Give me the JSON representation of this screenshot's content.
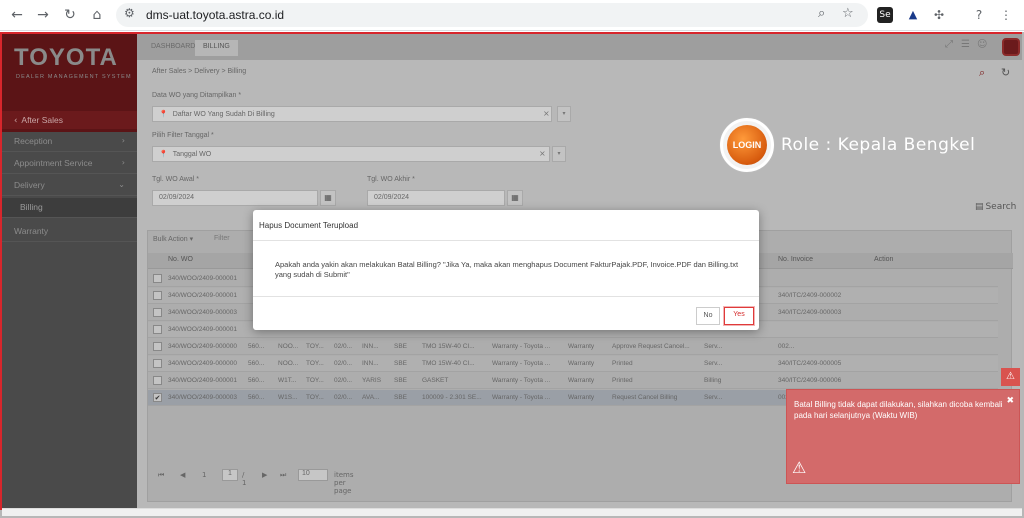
{
  "browser": {
    "url": "dms-uat.toyota.astra.co.id"
  },
  "brand": {
    "title": "TOYOTA",
    "subtitle": "DEALER MANAGEMENT SYSTEM"
  },
  "sidebar": {
    "section": "After Sales",
    "items": [
      {
        "label": "Reception",
        "chevron": "›"
      },
      {
        "label": "Appointment Service",
        "chevron": "›"
      },
      {
        "label": "Delivery",
        "chevron": "⌄"
      },
      {
        "label": "Billing",
        "chevron": ""
      },
      {
        "label": "Warranty",
        "chevron": ""
      }
    ]
  },
  "topbar": {
    "tabs": [
      "DASHBOARD",
      "BILLING"
    ]
  },
  "breadcrumb": "After Sales > Delivery > Billing",
  "form": {
    "data_wo_label": "Data WO yang Ditampilkan *",
    "data_wo_value": "Daftar WO Yang Sudah Di Billing",
    "filter_label": "Pilih Filter Tanggal *",
    "filter_value": "Tanggal WO",
    "wo_awal_label": "Tgl. WO Awal *",
    "wo_awal_value": "02/09/2024",
    "wo_akhir_label": "Tgl. WO Akhir *",
    "wo_akhir_value": "02/09/2024",
    "search_label": "Search"
  },
  "grid": {
    "bulk_action": "Bulk Action ▾",
    "filter": "Filter",
    "headers": [
      "No. WO",
      "No. Invoice",
      "Action"
    ],
    "rows": [
      {
        "cells": [
          "340/WOO/2409-000001",
          "",
          "",
          "",
          "",
          "",
          "",
          "",
          "",
          "",
          "",
          "",
          "",
          ""
        ],
        "selected": false
      },
      {
        "cells": [
          "340/WOO/2409-000001",
          "",
          "",
          "",
          "",
          "",
          "",
          "",
          "",
          "",
          "",
          "",
          "340/ITC/2409-000002",
          ""
        ],
        "selected": false
      },
      {
        "cells": [
          "340/WOO/2409-000003",
          "",
          "",
          "",
          "",
          "",
          "",
          "",
          "",
          "",
          "",
          "",
          "340/ITC/2409-000003",
          ""
        ],
        "selected": false
      },
      {
        "cells": [
          "340/WOO/2409-000001",
          "",
          "",
          "",
          "",
          "",
          "",
          "",
          "",
          "",
          "",
          "",
          "",
          ""
        ],
        "selected": false
      },
      {
        "cells": [
          "340/WOO/2409-000000",
          "560...",
          "NOO...",
          "TOY...",
          "02/0...",
          "INN...",
          "SBE",
          "TMO 15W-40 CI...",
          "Warranty - Toyota ...",
          "Warranty",
          "Approve Request Cancel...",
          "Serv...",
          "002...",
          ""
        ],
        "selected": false
      },
      {
        "cells": [
          "340/WOO/2409-000000",
          "560...",
          "NOO...",
          "TOY...",
          "02/0...",
          "INN...",
          "SBE",
          "TMO 15W-40 CI...",
          "Warranty - Toyota ...",
          "Warranty",
          "Printed",
          "Serv...",
          "340/ITC/2409-000005",
          ""
        ],
        "selected": false
      },
      {
        "cells": [
          "340/WOO/2409-000001",
          "560...",
          "W1T...",
          "TOY...",
          "02/0...",
          "YARIS",
          "SBE",
          "GASKET",
          "Warranty - Toyota ...",
          "Warranty",
          "Printed",
          "Billing",
          "340/ITC/2409-000006",
          ""
        ],
        "selected": false
      },
      {
        "cells": [
          "340/WOO/2409-000003",
          "560...",
          "W1S...",
          "TOY...",
          "02/0...",
          "AVA...",
          "SBE",
          "100009 - 2.301 SE...",
          "Warranty - Toyota ...",
          "Warranty",
          "Request Cancel Billing",
          "Serv...",
          "002...",
          ""
        ],
        "selected": true
      }
    ],
    "pager": {
      "first": "⏮",
      "prev": "◀",
      "page_label": "1",
      "page_value": "1",
      "of": "/ 1",
      "next": "▶",
      "last": "⏭",
      "size": "10",
      "size_label": "items per page"
    }
  },
  "badge": {
    "logo_text": "LOGIN",
    "role": "Role : Kepala Bengkel"
  },
  "modal": {
    "title": "Hapus Document Terupload",
    "message": "Apakah anda yakin akan melakukan Batal Billing? \"Jika Ya, maka akan menghapus Document FakturPajak.PDF, Invoice.PDF dan Billing.txt yang sudah di Submit\"",
    "no_label": "No",
    "yes_label": "Yes"
  },
  "toast": {
    "message": "Batal Billing tidak dapat dilakukan, silahkan dicoba kembali pada hari selanjutnya (Waktu WIB)",
    "close": "✖"
  },
  "colors": {
    "brand_red": "#d7262c",
    "toast_bg": "#d36a6a"
  }
}
